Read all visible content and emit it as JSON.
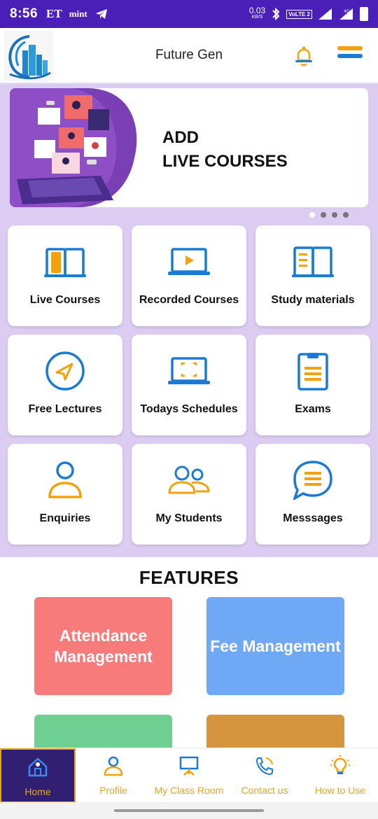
{
  "status_bar": {
    "time": "8:56",
    "et": "ET",
    "mint": "mint",
    "speed": "0.03",
    "speed_unit": "KB/S",
    "volte": "VoLTE 2",
    "network": "4G"
  },
  "header": {
    "title": "Future Gen"
  },
  "banner": {
    "line1": "ADD",
    "line2": "LIVE COURSES",
    "page_count": 4,
    "active_page": 1
  },
  "tiles": [
    {
      "label": "Live Courses",
      "icon": "open-book-icon"
    },
    {
      "label": "Recorded Courses",
      "icon": "laptop-play-icon"
    },
    {
      "label": "Study materials",
      "icon": "book-notes-icon"
    },
    {
      "label": "Free Lectures",
      "icon": "send-circle-icon"
    },
    {
      "label": "Todays Schedules",
      "icon": "laptop-frame-icon"
    },
    {
      "label": "Exams",
      "icon": "clipboard-icon"
    },
    {
      "label": "Enquiries",
      "icon": "user-icon"
    },
    {
      "label": "My Students",
      "icon": "users-icon"
    },
    {
      "label": "Messsages",
      "icon": "chat-bubble-icon"
    }
  ],
  "features": {
    "title": "FEATURES",
    "cards": [
      {
        "label": "Attendance Management",
        "color": "#f77b7b"
      },
      {
        "label": "Fee Management",
        "color": "#6fa8f5"
      },
      {
        "label": "",
        "color": "#6ecf92"
      },
      {
        "label": "",
        "color": "#d4953e"
      }
    ]
  },
  "bottom_nav": [
    {
      "label": "Home",
      "icon": "home-icon",
      "active": true
    },
    {
      "label": "Profile",
      "icon": "profile-icon",
      "active": false
    },
    {
      "label": "My Class Room",
      "icon": "classroom-icon",
      "active": false
    },
    {
      "label": "Contact us",
      "icon": "phone-icon",
      "active": false
    },
    {
      "label": "How to Use",
      "icon": "bulb-icon",
      "active": false
    }
  ],
  "colors": {
    "status_bar": "#4a1fb8",
    "accent_orange": "#f2a20c",
    "accent_blue": "#1a7ad4",
    "lavender": "#dcccf2",
    "nav_active_bg": "#311f72"
  }
}
